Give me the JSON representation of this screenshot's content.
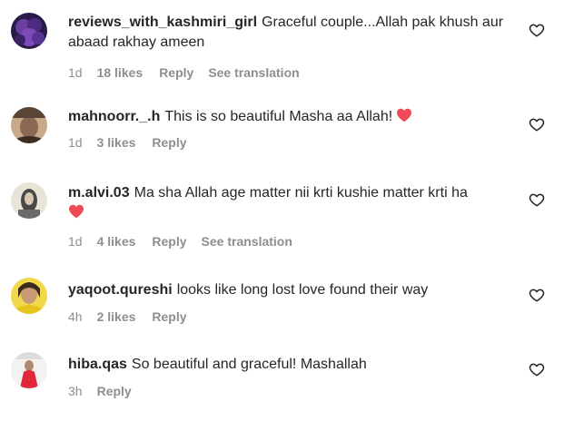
{
  "comments": [
    {
      "username": "reviews_with_kashmiri_girl",
      "text": "Graceful couple...Allah pak khush aur abaad rakhay ameen",
      "time": "1d",
      "likes": "18 likes",
      "reply": "Reply",
      "translate": "See translation",
      "heart_emoji": false
    },
    {
      "username": "mahnoorr._.h",
      "text": "This is so beautiful Masha aa Allah!",
      "time": "1d",
      "likes": "3 likes",
      "reply": "Reply",
      "heart_emoji": true
    },
    {
      "username": "m.alvi.03",
      "text": "Ma sha Allah age matter nii krti kushie matter krti ha",
      "time": "1d",
      "likes": "4 likes",
      "reply": "Reply",
      "translate": "See translation",
      "heart_emoji": true
    },
    {
      "username": "yaqoot.qureshi",
      "text": "looks like long lost love found their way",
      "time": "4h",
      "likes": "2 likes",
      "reply": "Reply",
      "heart_emoji": false
    },
    {
      "username": "hiba.qas",
      "text": "So beautiful and graceful! Mashallah",
      "time": "3h",
      "reply": "Reply",
      "heart_emoji": false
    }
  ],
  "colors": {
    "text": "#262626",
    "meta": "#8e8e8e",
    "heart_emoji": "#ed4956"
  },
  "icons": {
    "like": "heart-outline-icon",
    "emoji": "red-heart-emoji"
  }
}
